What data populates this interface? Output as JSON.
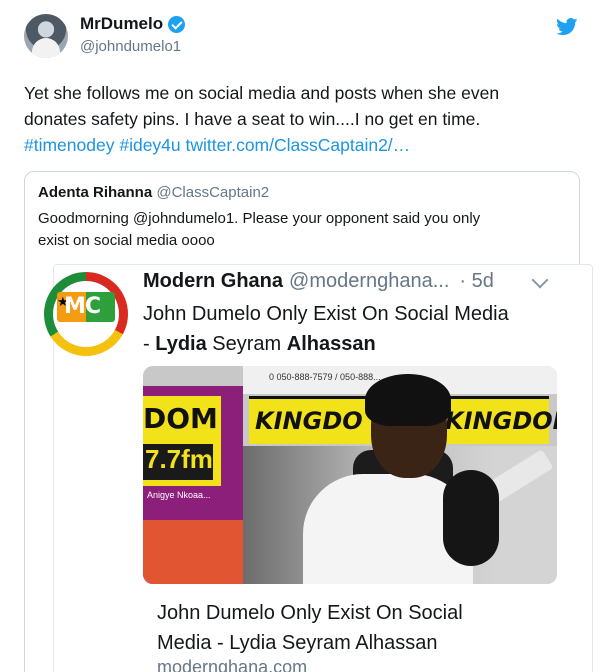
{
  "tweet": {
    "author_name": "MrDumelo",
    "author_handle": "@johndumelo1",
    "text_line1": "Yet she follows me on social media and posts when she even",
    "text_line2": "donates safety pins. I have a seat to win....I no get en time.",
    "link_text": "#timenodey #idey4u twitter.com/ClassCaptain2/…"
  },
  "quote": {
    "author_name": "Adenta Rihanna",
    "author_handle": "@ClassCaptain2",
    "text_line1": "Goodmorning @johndumelo1. Please your opponent said you only",
    "text_line2": "exist on social media oooo"
  },
  "inner_tweet": {
    "author_name": "Modern Ghana",
    "author_handle": "@modernghana...",
    "time": "· 5d",
    "text_line1": "John Dumelo Only Exist On Social Media",
    "text_line2_prefix": "- ",
    "text_line2_bold1": "Lydia",
    "text_line2_mid": " Seyram ",
    "text_line2_bold2": "Alhassan",
    "logo_text": "MC"
  },
  "photo": {
    "left_sign_text": "DOM",
    "left_freq_text": "7.7fm",
    "left_small_text": "Anigye Nkoaa...",
    "phone_strip_text": "0 050-888-7579 / 050-888...",
    "banner_text_1": "KINGDO",
    "banner_text_2": "KINGDOM"
  },
  "card": {
    "title_line1": "John Dumelo Only Exist On Social",
    "title_line2": "Media - Lydia Seyram Alhassan",
    "url": "modernghana.com"
  },
  "colors": {
    "twitter_blue": "#1da1f2",
    "link": "#1b95e0",
    "secondary_text": "#657786"
  }
}
